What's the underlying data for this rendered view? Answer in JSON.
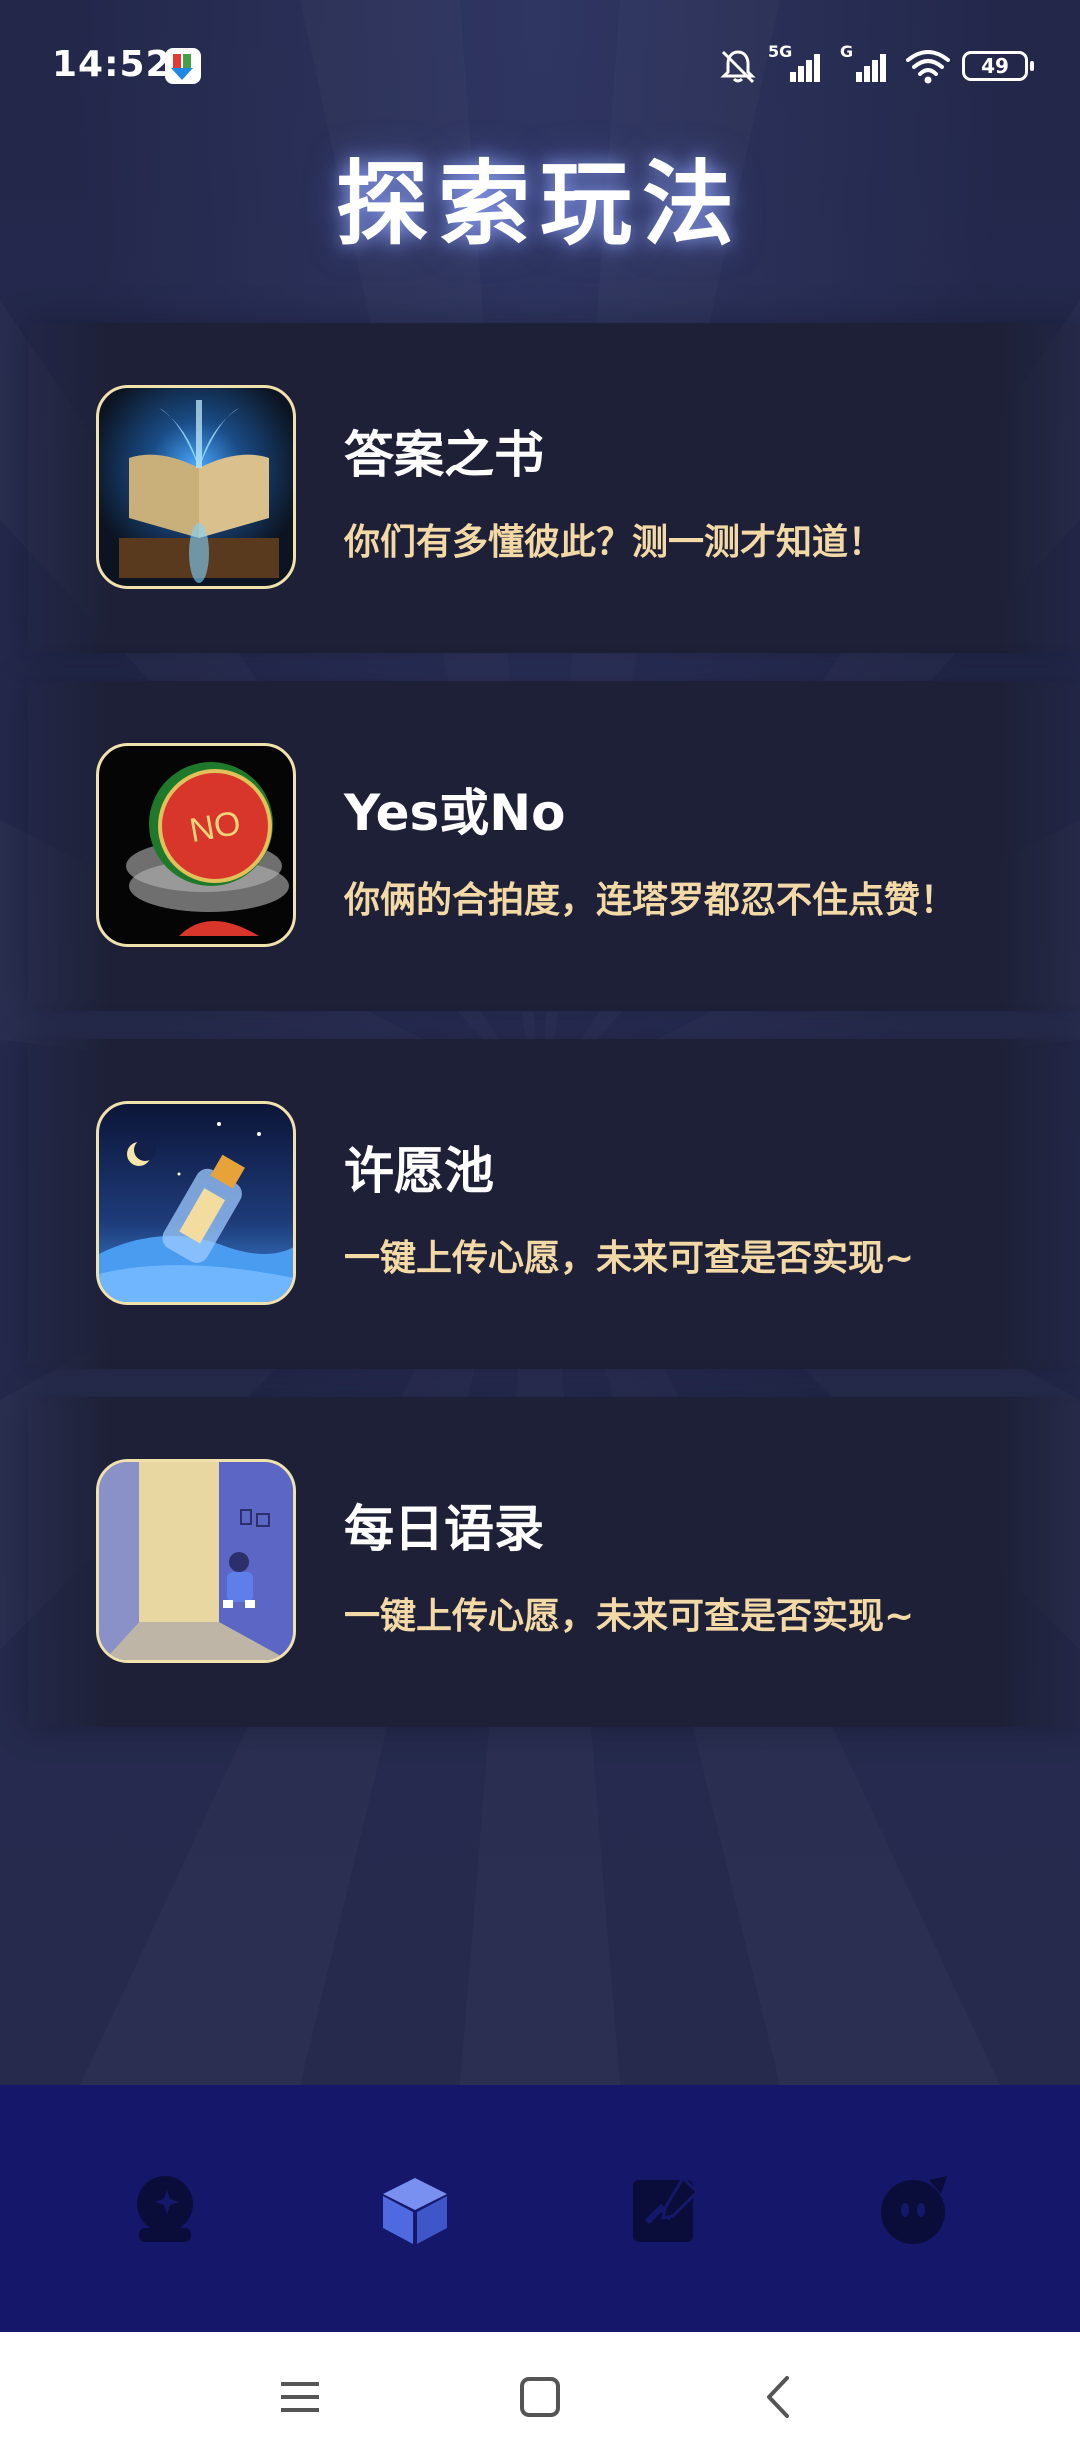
{
  "status_bar": {
    "time": "14:52",
    "network_1": "5G",
    "network_2": "G",
    "battery": "49"
  },
  "header": {
    "title": "探索玩法"
  },
  "cards": [
    {
      "title": "答案之书",
      "description": "你们有多懂彼此？测一测才知道！",
      "icon": "glowing-book-image"
    },
    {
      "title": "Yes或No",
      "description": "你俩的合拍度，连塔罗都忍不住点赞！",
      "icon": "yes-no-coin-image",
      "coin_text": "NO"
    },
    {
      "title": "许愿池",
      "description": "一键上传心愿，未来可查是否实现~",
      "icon": "wish-bottle-image"
    },
    {
      "title": "每日语录",
      "description": "一键上传心愿，未来可查是否实现~",
      "icon": "quiet-room-image"
    }
  ],
  "tab_bar": {
    "tabs": [
      {
        "name": "crystal-ball",
        "active": false
      },
      {
        "name": "cube",
        "active": true
      },
      {
        "name": "note-edit",
        "active": false
      },
      {
        "name": "face",
        "active": false
      }
    ],
    "active_color": "#4f6ae0",
    "inactive_color": "#0a0d3a"
  },
  "colors": {
    "background": "#23284a",
    "card": "#1d2036",
    "card_title": "#ffffff",
    "card_desc": "#f2d9a6",
    "thumb_border": "#f1e1ad",
    "tab_bar": "#15186a"
  }
}
